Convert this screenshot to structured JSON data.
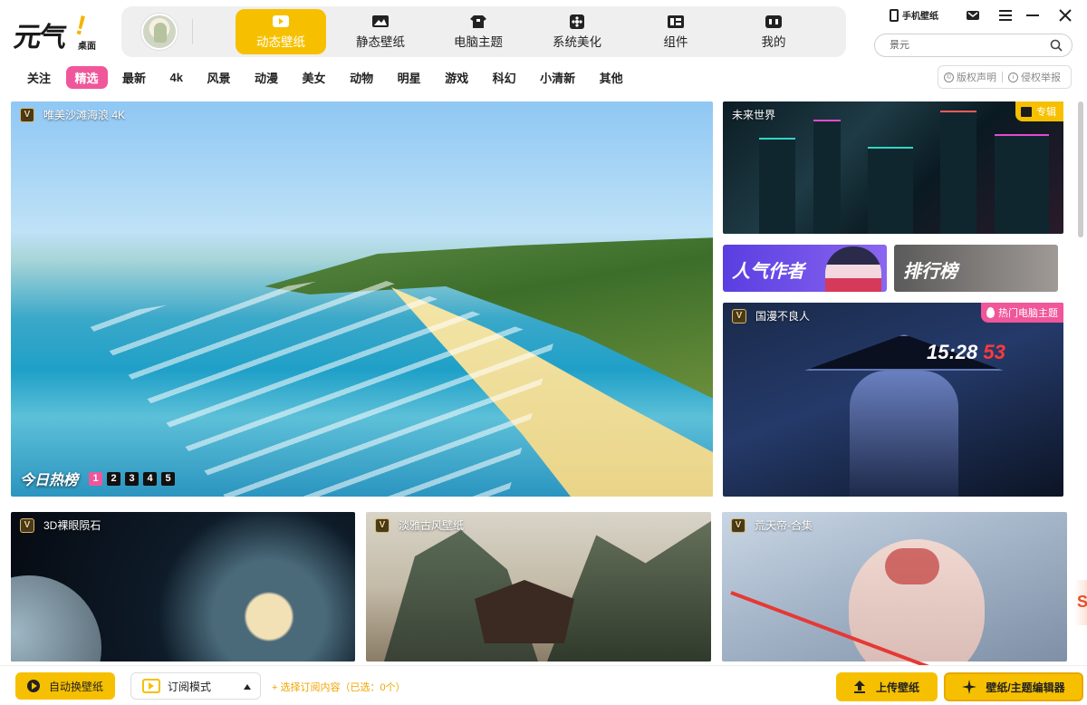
{
  "app": {
    "logo_text": "元气",
    "logo_sub": "桌面"
  },
  "nav": [
    {
      "label": "动态壁纸",
      "icon": "play-icon",
      "active": true
    },
    {
      "label": "静态壁纸",
      "icon": "image-icon",
      "active": false
    },
    {
      "label": "电脑主题",
      "icon": "shirt-icon",
      "active": false
    },
    {
      "label": "系统美化",
      "icon": "flower-icon",
      "active": false
    },
    {
      "label": "组件",
      "icon": "widget-icon",
      "active": false
    },
    {
      "label": "我的",
      "icon": "profile-icon",
      "active": false
    }
  ],
  "topright": {
    "mobile_label": "手机壁纸"
  },
  "search": {
    "placeholder": "景元"
  },
  "categories": [
    "关注",
    "精选",
    "最新",
    "4k",
    "风景",
    "动漫",
    "美女",
    "动物",
    "明星",
    "游戏",
    "科幻",
    "小清新",
    "其他"
  ],
  "active_category": "精选",
  "rights": {
    "copyright": "版权声明",
    "report": "侵权举报"
  },
  "feature": {
    "title": "唯美沙滩海浪 4K",
    "badge": "V",
    "hot_label": "今日热榜",
    "pages": [
      "1",
      "2",
      "3",
      "4",
      "5"
    ],
    "active_page": "1"
  },
  "side": {
    "future_title": "未来世界",
    "future_tag": "专辑",
    "authors_label": "人气作者",
    "rank_label": "排行榜",
    "samurai_title": "国漫不良人",
    "samurai_tag": "热门电脑主题",
    "samurai_clock": "15:28",
    "samurai_num": "53"
  },
  "grid": [
    {
      "title": "3D裸眼陨石",
      "badge": "V"
    },
    {
      "title": "淡雅古风壁纸",
      "badge": "V"
    },
    {
      "title": "荒天帝-合集",
      "badge": "V"
    }
  ],
  "bottom": {
    "auto_label": "自动换壁纸",
    "subscribe_mode": "订阅模式",
    "choose_text": "+ 选择订阅内容（已选：0个）",
    "upload_label": "上传壁纸",
    "editor_label": "壁纸/主题编辑器"
  },
  "colors": {
    "accent": "#f6c000",
    "pink": "#f0569a"
  }
}
